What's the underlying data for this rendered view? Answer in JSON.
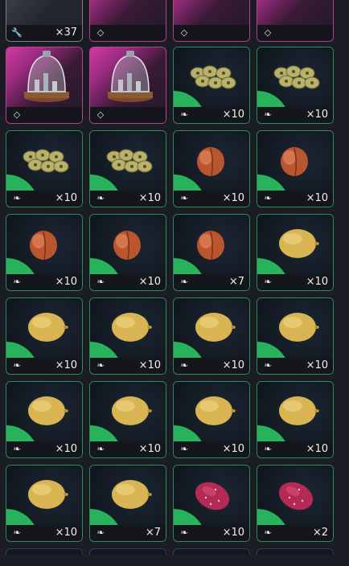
{
  "colors": {
    "common_border": "#2f8a55",
    "rare_border": "#b83f94",
    "tool_border": "#7b7f8a",
    "accent_green": "#27b25b",
    "accent_pink": "#d23aa1"
  },
  "slots": [
    {
      "kind": "tool",
      "item": "tool-item",
      "badge": "wrench-icon",
      "qty": "×37"
    },
    {
      "kind": "rare",
      "item": "rare-item",
      "badge": "diamond-icon",
      "qty": ""
    },
    {
      "kind": "rare",
      "item": "rare-item",
      "badge": "diamond-icon",
      "qty": ""
    },
    {
      "kind": "rare",
      "item": "rare-item",
      "badge": "diamond-icon",
      "qty": ""
    },
    {
      "kind": "rare",
      "item": "glass-dome",
      "badge": "diamond-icon",
      "qty": ""
    },
    {
      "kind": "rare",
      "item": "glass-dome",
      "badge": "diamond-icon",
      "qty": ""
    },
    {
      "kind": "common",
      "item": "olives",
      "badge": "sprout-icon",
      "qty": "×10"
    },
    {
      "kind": "common",
      "item": "olives",
      "badge": "sprout-icon",
      "qty": "×10"
    },
    {
      "kind": "common",
      "item": "olives",
      "badge": "sprout-icon",
      "qty": "×10"
    },
    {
      "kind": "common",
      "item": "olives",
      "badge": "sprout-icon",
      "qty": "×10"
    },
    {
      "kind": "common",
      "item": "peach",
      "badge": "sprout-icon",
      "qty": "×10"
    },
    {
      "kind": "common",
      "item": "peach",
      "badge": "sprout-icon",
      "qty": "×10"
    },
    {
      "kind": "common",
      "item": "peach",
      "badge": "sprout-icon",
      "qty": "×10"
    },
    {
      "kind": "common",
      "item": "peach",
      "badge": "sprout-icon",
      "qty": "×10"
    },
    {
      "kind": "common",
      "item": "peach",
      "badge": "sprout-icon",
      "qty": "×7"
    },
    {
      "kind": "common",
      "item": "lemon",
      "badge": "sprout-icon",
      "qty": "×10"
    },
    {
      "kind": "common",
      "item": "lemon",
      "badge": "sprout-icon",
      "qty": "×10"
    },
    {
      "kind": "common",
      "item": "lemon",
      "badge": "sprout-icon",
      "qty": "×10"
    },
    {
      "kind": "common",
      "item": "lemon",
      "badge": "sprout-icon",
      "qty": "×10"
    },
    {
      "kind": "common",
      "item": "lemon",
      "badge": "sprout-icon",
      "qty": "×10"
    },
    {
      "kind": "common",
      "item": "lemon",
      "badge": "sprout-icon",
      "qty": "×10"
    },
    {
      "kind": "common",
      "item": "lemon",
      "badge": "sprout-icon",
      "qty": "×10"
    },
    {
      "kind": "common",
      "item": "lemon",
      "badge": "sprout-icon",
      "qty": "×10"
    },
    {
      "kind": "common",
      "item": "lemon",
      "badge": "sprout-icon",
      "qty": "×10"
    },
    {
      "kind": "common",
      "item": "lemon",
      "badge": "sprout-icon",
      "qty": "×10"
    },
    {
      "kind": "common",
      "item": "lemon",
      "badge": "sprout-icon",
      "qty": "×7"
    },
    {
      "kind": "common",
      "item": "dragon-fruit",
      "badge": "sprout-icon",
      "qty": "×10"
    },
    {
      "kind": "common",
      "item": "dragon-fruit",
      "badge": "sprout-icon",
      "qty": "×2"
    }
  ]
}
